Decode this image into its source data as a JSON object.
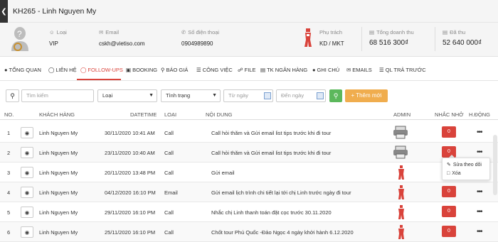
{
  "header": {
    "back_icon": "chevron-left-icon",
    "title": "KH265 - Linh Nguyen My"
  },
  "profile": {
    "type_label": "Loại",
    "type_value": "VIP",
    "email_label": "Email",
    "email_value": "cskh@vietiso.com",
    "phone_label": "Số điện thoại",
    "phone_value": "0904989890",
    "owner_label": "Phụ trách",
    "owner_value": "KD / MKT",
    "revenue_label": "Tổng doanh thu",
    "revenue_value": "68 516 300₫",
    "collected_label": "Đã thu",
    "collected_value": "52 640 000₫"
  },
  "tabs": [
    {
      "label": "TỔNG QUAN",
      "icon": "info-icon"
    },
    {
      "label": "LIÊN HỆ",
      "icon": "info-circle-icon"
    },
    {
      "label": "FOLLOW-UPS",
      "icon": "clock-icon",
      "active": true
    },
    {
      "label": "BOOKING",
      "icon": "truck-icon"
    },
    {
      "label": "BÁO GIÁ",
      "icon": "search-icon"
    },
    {
      "label": "CÔNG VIỆC",
      "icon": "list-icon"
    },
    {
      "label": "FILE",
      "icon": "paperclip-icon"
    },
    {
      "label": "TK NGÂN HÀNG",
      "icon": "bank-icon"
    },
    {
      "label": "GHI CHÚ",
      "icon": "comment-icon"
    },
    {
      "label": "EMAILS",
      "icon": "envelope-icon"
    },
    {
      "label": "QL TRẢ TRƯỚC",
      "icon": "list-icon"
    }
  ],
  "filters": {
    "search_placeholder": "Tìm kiếm",
    "type_select": "Loại",
    "status_select": "Tình trạng",
    "from_date_placeholder": "Từ ngày",
    "to_date_placeholder": "Đến ngày",
    "add_label": "+ Thêm mới"
  },
  "table": {
    "headers": [
      "NO.",
      "KHÁCH HÀNG",
      "DATETIME",
      "LOẠI",
      "NỘI DUNG",
      "ADMIN",
      "NHẮC NHỞ",
      "H.ĐỘNG"
    ],
    "rows": [
      {
        "no": "1",
        "customer": "Linh Nguyen My",
        "datetime": "30/11/2020 10:41 AM",
        "type": "Call",
        "content": "Call hỏi thăm và Gửi email list tips trước khi đi tour",
        "admin": "printer-avatar",
        "reminder": "0"
      },
      {
        "no": "2",
        "customer": "Linh Nguyen My",
        "datetime": "23/11/2020 10:40 AM",
        "type": "Call",
        "content": "Call hỏi thăm và Gửi email list tips trước khi đi tour",
        "admin": "printer-avatar",
        "reminder": "0"
      },
      {
        "no": "3",
        "customer": "Linh Nguyen My",
        "datetime": "20/11/2020 13:48 PM",
        "type": "Call",
        "content": "Gửi email",
        "admin": "figure-avatar",
        "reminder": "0"
      },
      {
        "no": "4",
        "customer": "Linh Nguyen My",
        "datetime": "04/12/2020 16:10 PM",
        "type": "Email",
        "content": "Gửi email lịch trình chi tiết lại tới chị Linh trước ngày đi tour",
        "admin": "figure-avatar",
        "reminder": "0"
      },
      {
        "no": "5",
        "customer": "Linh Nguyen My",
        "datetime": "29/11/2020 16:10 PM",
        "type": "Call",
        "content": "Nhắc chị Linh thanh toán đặt cọc trước 30.11.2020",
        "admin": "figure-avatar",
        "reminder": "0"
      },
      {
        "no": "6",
        "customer": "Linh Nguyen My",
        "datetime": "25/11/2020 16:10 PM",
        "type": "Call",
        "content": "Chốt tour Phú Quốc -Đảo Ngọc 4 ngày khởi hành 6.12.2020",
        "admin": "figure-avatar",
        "reminder": "0"
      }
    ]
  },
  "action_menu": {
    "edit_label": "Sửa theo dõi",
    "delete_label": "Xóa"
  },
  "colors": {
    "accent": "#d9433b",
    "search_button": "#5cb85c",
    "add_button": "#f0ad4e"
  }
}
